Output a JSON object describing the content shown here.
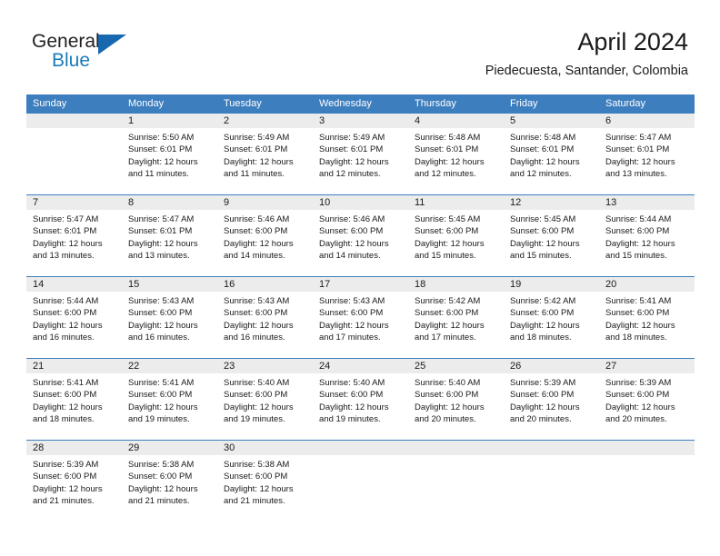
{
  "brand": {
    "name_top": "General",
    "name_bottom": "Blue",
    "flag_icon": "triangle-flag-icon",
    "blue_hex": "#1868b0",
    "text_hex": "#231f20"
  },
  "header": {
    "month_title": "April 2024",
    "location": "Piedecuesta, Santander, Colombia"
  },
  "theme": {
    "header_blue": "#3d7ebf",
    "day_number_band": "#ececec",
    "cell_background": "#ffffff",
    "text": "#1a1a1a"
  },
  "weekdays": [
    "Sunday",
    "Monday",
    "Tuesday",
    "Wednesday",
    "Thursday",
    "Friday",
    "Saturday"
  ],
  "labels": {
    "sunrise_prefix": "Sunrise:",
    "sunset_prefix": "Sunset:",
    "daylight_prefix": "Daylight:"
  },
  "weeks": [
    [
      {
        "day": "",
        "lines": []
      },
      {
        "day": "1",
        "lines": [
          "Sunrise: 5:50 AM",
          "Sunset: 6:01 PM",
          "Daylight: 12 hours",
          "and 11 minutes."
        ]
      },
      {
        "day": "2",
        "lines": [
          "Sunrise: 5:49 AM",
          "Sunset: 6:01 PM",
          "Daylight: 12 hours",
          "and 11 minutes."
        ]
      },
      {
        "day": "3",
        "lines": [
          "Sunrise: 5:49 AM",
          "Sunset: 6:01 PM",
          "Daylight: 12 hours",
          "and 12 minutes."
        ]
      },
      {
        "day": "4",
        "lines": [
          "Sunrise: 5:48 AM",
          "Sunset: 6:01 PM",
          "Daylight: 12 hours",
          "and 12 minutes."
        ]
      },
      {
        "day": "5",
        "lines": [
          "Sunrise: 5:48 AM",
          "Sunset: 6:01 PM",
          "Daylight: 12 hours",
          "and 12 minutes."
        ]
      },
      {
        "day": "6",
        "lines": [
          "Sunrise: 5:47 AM",
          "Sunset: 6:01 PM",
          "Daylight: 12 hours",
          "and 13 minutes."
        ]
      }
    ],
    [
      {
        "day": "7",
        "lines": [
          "Sunrise: 5:47 AM",
          "Sunset: 6:01 PM",
          "Daylight: 12 hours",
          "and 13 minutes."
        ]
      },
      {
        "day": "8",
        "lines": [
          "Sunrise: 5:47 AM",
          "Sunset: 6:01 PM",
          "Daylight: 12 hours",
          "and 13 minutes."
        ]
      },
      {
        "day": "9",
        "lines": [
          "Sunrise: 5:46 AM",
          "Sunset: 6:00 PM",
          "Daylight: 12 hours",
          "and 14 minutes."
        ]
      },
      {
        "day": "10",
        "lines": [
          "Sunrise: 5:46 AM",
          "Sunset: 6:00 PM",
          "Daylight: 12 hours",
          "and 14 minutes."
        ]
      },
      {
        "day": "11",
        "lines": [
          "Sunrise: 5:45 AM",
          "Sunset: 6:00 PM",
          "Daylight: 12 hours",
          "and 15 minutes."
        ]
      },
      {
        "day": "12",
        "lines": [
          "Sunrise: 5:45 AM",
          "Sunset: 6:00 PM",
          "Daylight: 12 hours",
          "and 15 minutes."
        ]
      },
      {
        "day": "13",
        "lines": [
          "Sunrise: 5:44 AM",
          "Sunset: 6:00 PM",
          "Daylight: 12 hours",
          "and 15 minutes."
        ]
      }
    ],
    [
      {
        "day": "14",
        "lines": [
          "Sunrise: 5:44 AM",
          "Sunset: 6:00 PM",
          "Daylight: 12 hours",
          "and 16 minutes."
        ]
      },
      {
        "day": "15",
        "lines": [
          "Sunrise: 5:43 AM",
          "Sunset: 6:00 PM",
          "Daylight: 12 hours",
          "and 16 minutes."
        ]
      },
      {
        "day": "16",
        "lines": [
          "Sunrise: 5:43 AM",
          "Sunset: 6:00 PM",
          "Daylight: 12 hours",
          "and 16 minutes."
        ]
      },
      {
        "day": "17",
        "lines": [
          "Sunrise: 5:43 AM",
          "Sunset: 6:00 PM",
          "Daylight: 12 hours",
          "and 17 minutes."
        ]
      },
      {
        "day": "18",
        "lines": [
          "Sunrise: 5:42 AM",
          "Sunset: 6:00 PM",
          "Daylight: 12 hours",
          "and 17 minutes."
        ]
      },
      {
        "day": "19",
        "lines": [
          "Sunrise: 5:42 AM",
          "Sunset: 6:00 PM",
          "Daylight: 12 hours",
          "and 18 minutes."
        ]
      },
      {
        "day": "20",
        "lines": [
          "Sunrise: 5:41 AM",
          "Sunset: 6:00 PM",
          "Daylight: 12 hours",
          "and 18 minutes."
        ]
      }
    ],
    [
      {
        "day": "21",
        "lines": [
          "Sunrise: 5:41 AM",
          "Sunset: 6:00 PM",
          "Daylight: 12 hours",
          "and 18 minutes."
        ]
      },
      {
        "day": "22",
        "lines": [
          "Sunrise: 5:41 AM",
          "Sunset: 6:00 PM",
          "Daylight: 12 hours",
          "and 19 minutes."
        ]
      },
      {
        "day": "23",
        "lines": [
          "Sunrise: 5:40 AM",
          "Sunset: 6:00 PM",
          "Daylight: 12 hours",
          "and 19 minutes."
        ]
      },
      {
        "day": "24",
        "lines": [
          "Sunrise: 5:40 AM",
          "Sunset: 6:00 PM",
          "Daylight: 12 hours",
          "and 19 minutes."
        ]
      },
      {
        "day": "25",
        "lines": [
          "Sunrise: 5:40 AM",
          "Sunset: 6:00 PM",
          "Daylight: 12 hours",
          "and 20 minutes."
        ]
      },
      {
        "day": "26",
        "lines": [
          "Sunrise: 5:39 AM",
          "Sunset: 6:00 PM",
          "Daylight: 12 hours",
          "and 20 minutes."
        ]
      },
      {
        "day": "27",
        "lines": [
          "Sunrise: 5:39 AM",
          "Sunset: 6:00 PM",
          "Daylight: 12 hours",
          "and 20 minutes."
        ]
      }
    ],
    [
      {
        "day": "28",
        "lines": [
          "Sunrise: 5:39 AM",
          "Sunset: 6:00 PM",
          "Daylight: 12 hours",
          "and 21 minutes."
        ]
      },
      {
        "day": "29",
        "lines": [
          "Sunrise: 5:38 AM",
          "Sunset: 6:00 PM",
          "Daylight: 12 hours",
          "and 21 minutes."
        ]
      },
      {
        "day": "30",
        "lines": [
          "Sunrise: 5:38 AM",
          "Sunset: 6:00 PM",
          "Daylight: 12 hours",
          "and 21 minutes."
        ]
      },
      {
        "day": "",
        "lines": []
      },
      {
        "day": "",
        "lines": []
      },
      {
        "day": "",
        "lines": []
      },
      {
        "day": "",
        "lines": []
      }
    ]
  ]
}
